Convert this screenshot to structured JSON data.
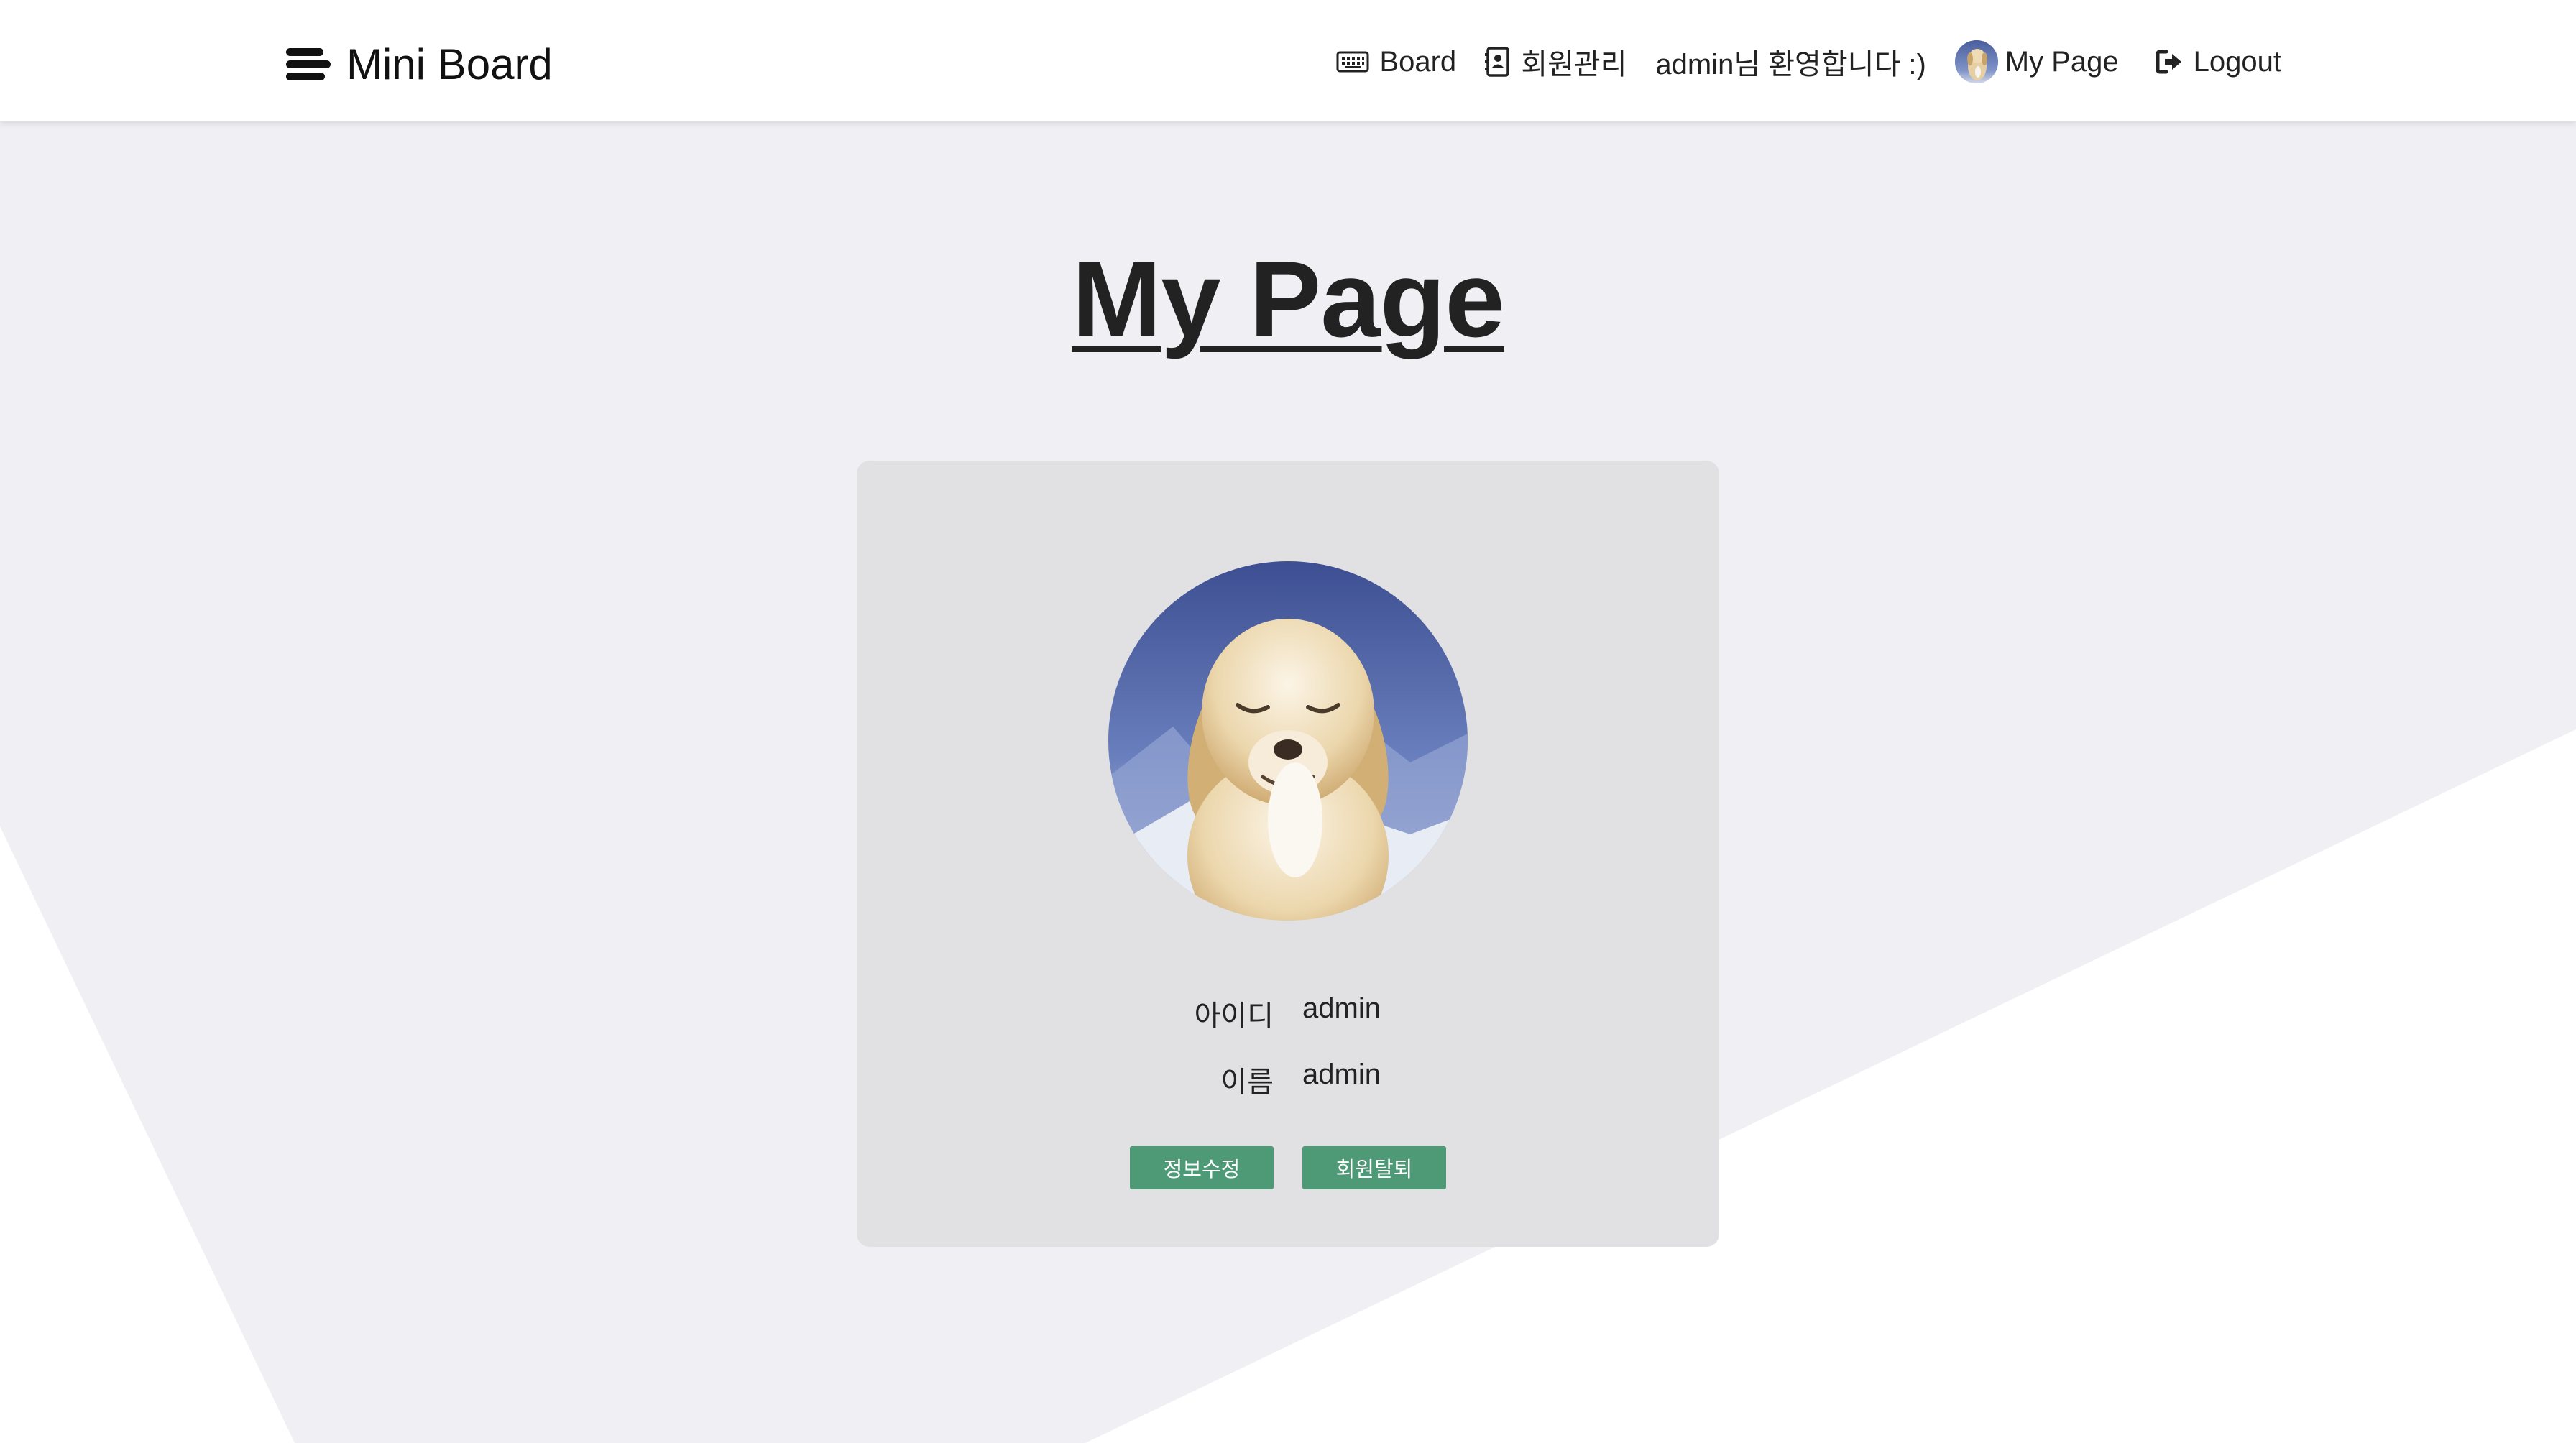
{
  "header": {
    "brand": "Mini Board",
    "nav": {
      "board": "Board",
      "members": "회원관리",
      "welcome": "admin님 환영합니다 :)",
      "mypage": "My Page",
      "logout": "Logout"
    }
  },
  "main": {
    "title": "My Page",
    "profile": {
      "id_label": "아이디",
      "id_value": "admin",
      "name_label": "이름",
      "name_value": "admin"
    },
    "buttons": {
      "edit": "정보수정",
      "withdraw": "회원탈퇴"
    }
  },
  "icons": {
    "brand": "bars-staggered-icon",
    "board": "keyboard-icon",
    "members": "address-book-icon",
    "logout": "logout-icon"
  },
  "colors": {
    "background": "#f0eff4",
    "header": "#ffffff",
    "card": "#e1e0e3",
    "button": "#4e9a77",
    "text": "#222222"
  }
}
